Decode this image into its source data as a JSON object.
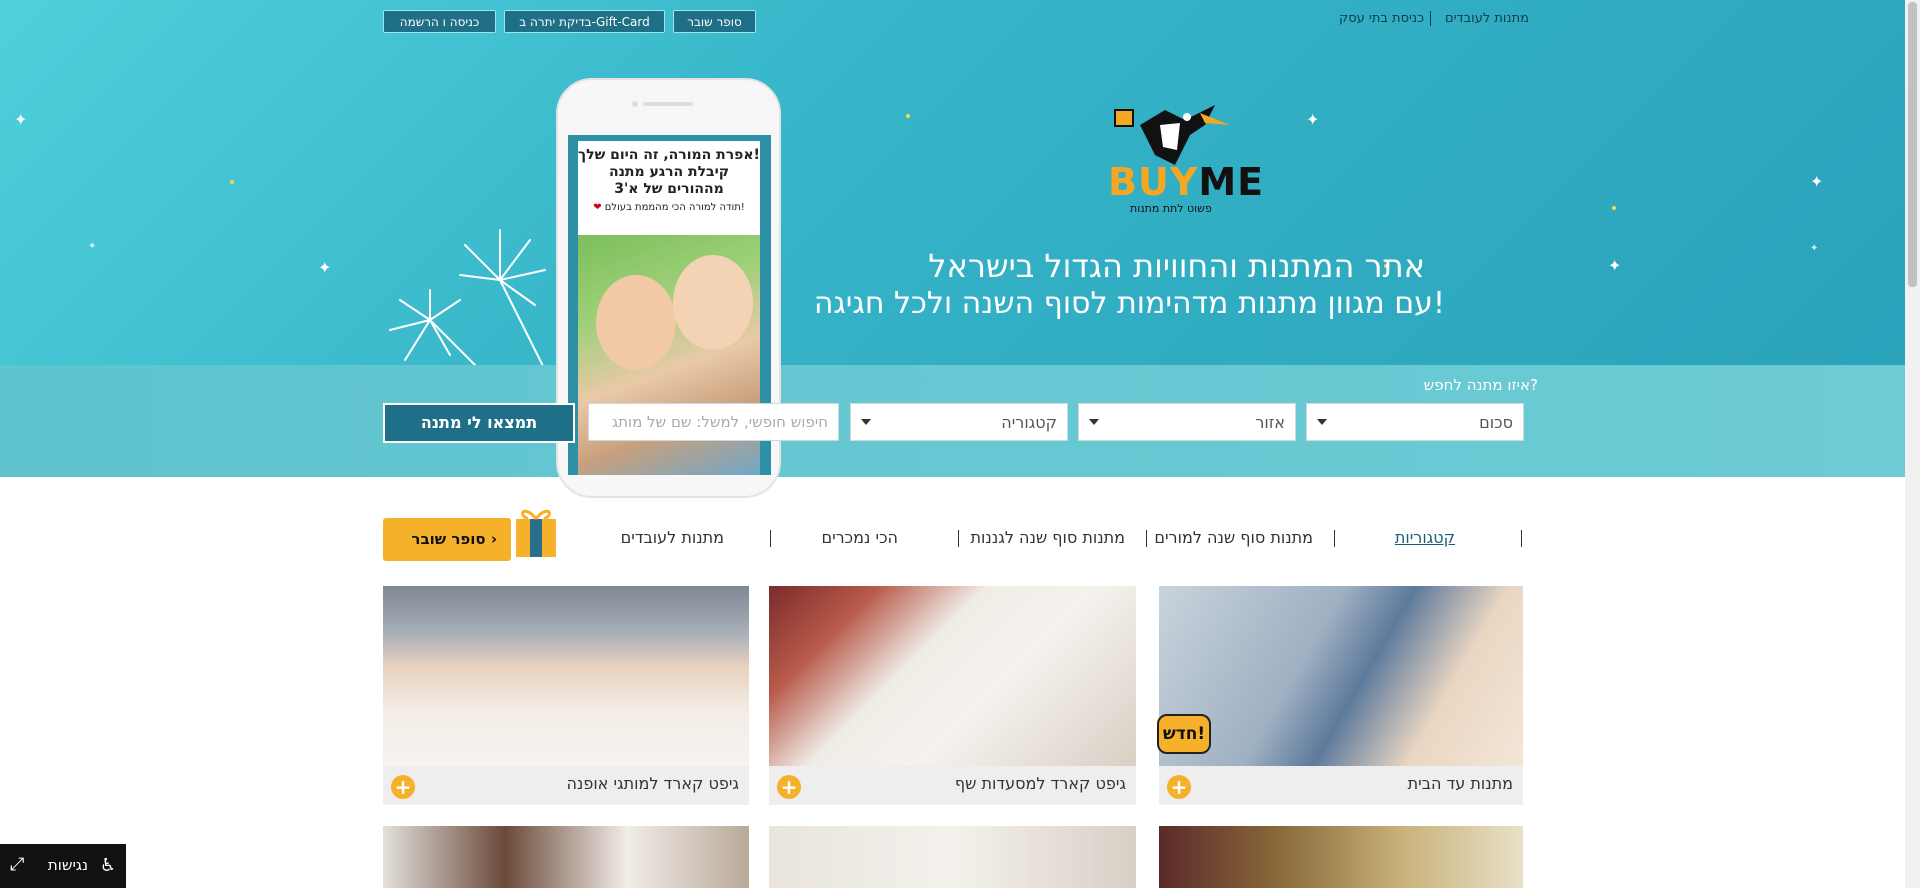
{
  "top_bar": {
    "buttons": [
      "סופר שובר",
      "בדיקת יתרה ב-Gift-Card",
      "כניסה ו הרשמה"
    ],
    "links": [
      "מתנות לעובדים",
      "כניסת בתי עסק"
    ]
  },
  "logo": {
    "brand_buy": "BUY",
    "brand_me": "ME",
    "tagline": "פשוט לתת מתנות"
  },
  "hero": {
    "headline": "אתר המתנות והחוויות הגדול בישראל",
    "subheadline": "עם מגוון מתנות מדהימות לסוף השנה ולכל חגיגה!"
  },
  "phone_card": {
    "line1": "אפרת המורה, זה היום שלך!",
    "line2": "קיבלת הרגע מתנה",
    "line3": "מההורים של א'3",
    "line4": "תודה למורה הכי מהממת בעולם!"
  },
  "search": {
    "label": "איזו מתנה לחפש?",
    "amount": "סכום",
    "region": "אזור",
    "category": "קטגוריה",
    "free_placeholder": "חיפוש חופשי, למשל: שם של מותג",
    "submit": "תמצאו לי מתנה"
  },
  "nav": {
    "items": [
      "קטגוריות",
      "מתנות סוף שנה למורים",
      "מתנות סוף שנה לגננות",
      "הכי נמכרים",
      "מתנות לעובדים"
    ],
    "voucher": "סופר שובר ›"
  },
  "tiles": [
    {
      "caption": "מתנות עד הבית",
      "badge": "חדש!"
    },
    {
      "caption": "גיפט קארד למסעדות שף"
    },
    {
      "caption": "גיפט קארד למותגי אופנה"
    }
  ],
  "accessibility": {
    "label": "נגישות"
  },
  "colors": {
    "hero": "#3fc0d0",
    "accent": "#f6b12b",
    "button_dark": "#1e6f87"
  }
}
